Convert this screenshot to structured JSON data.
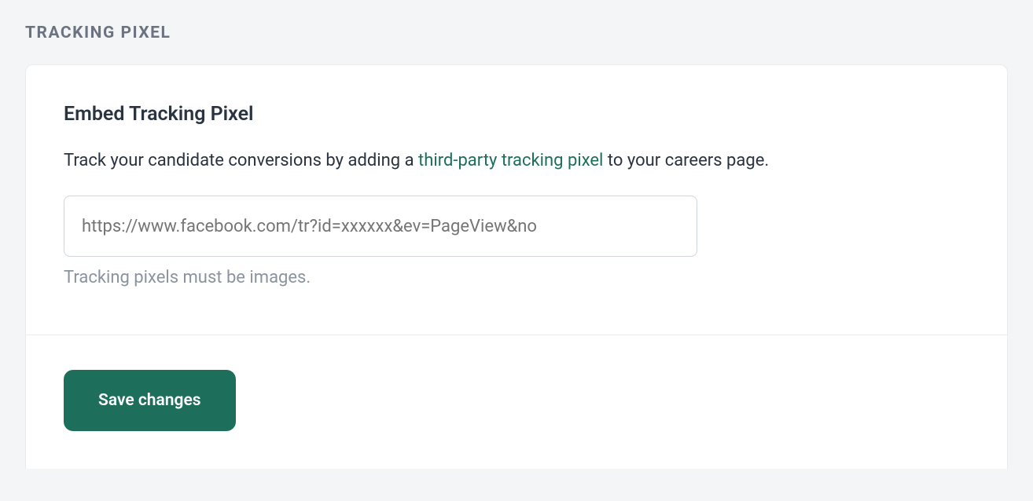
{
  "section": {
    "label": "TRACKING PIXEL"
  },
  "card": {
    "title": "Embed Tracking Pixel",
    "description_pre": "Track your candidate conversions by adding a ",
    "description_link": "third-party tracking pixel",
    "description_post": " to your careers page.",
    "input_placeholder": "https://www.facebook.com/tr?id=xxxxxx&ev=PageView&no",
    "helper_text": "Tracking pixels must be images."
  },
  "actions": {
    "save_label": "Save changes"
  },
  "colors": {
    "accent": "#1d6f5c",
    "page_bg": "#f4f5f6",
    "card_bg": "#ffffff",
    "border": "#e9ebed",
    "text_primary": "#2a3340",
    "text_muted": "#8a94a0",
    "label_muted": "#6b7280"
  }
}
